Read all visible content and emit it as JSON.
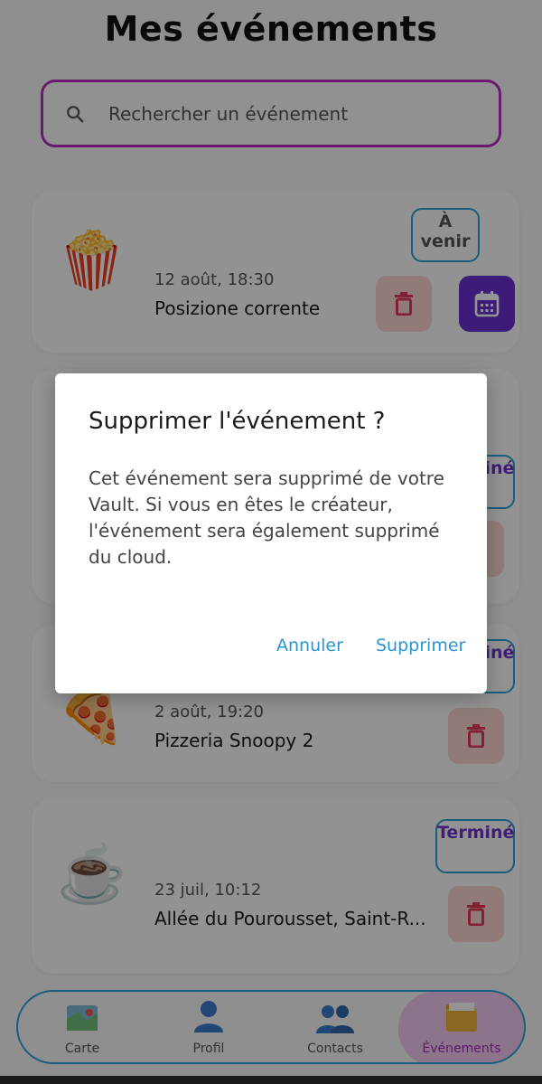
{
  "page": {
    "title": "Mes événements"
  },
  "search": {
    "placeholder": "Rechercher un événement",
    "value": ""
  },
  "events": [
    {
      "emoji": "🍿",
      "date": "12 août, 18:30",
      "place": "Posizione corrente",
      "status": "À venir"
    },
    {
      "emoji": "",
      "date": "",
      "place": "",
      "status": "Terminé"
    },
    {
      "emoji": "🍕",
      "date": "2 août, 19:20",
      "place": "Pizzeria Snoopy 2",
      "status": "Terminé"
    },
    {
      "emoji": "☕",
      "date": "23 juil, 10:12",
      "place": "Allée du Pourousset, Saint-R...",
      "status": "Terminé"
    }
  ],
  "nav": {
    "items": [
      {
        "label": "Carte",
        "icon": "map-icon"
      },
      {
        "label": "Profil",
        "icon": "profile-icon"
      },
      {
        "label": "Contacts",
        "icon": "contacts-icon"
      },
      {
        "label": "Événements",
        "icon": "events-folder-icon"
      }
    ],
    "active": "Événements"
  },
  "dialog": {
    "title": "Supprimer l'événement ?",
    "body": "Cet événement sera supprimé de votre Vault. Si vous en êtes le créateur, l'événement sera également supprimé du cloud.",
    "cancel_label": "Annuler",
    "confirm_label": "Supprimer"
  },
  "colors": {
    "accent_purple": "#6a2fd1",
    "search_border": "#b52bc4",
    "status_border": "#2aa0d8",
    "delete_bg": "#f9d4cf",
    "delete_icon": "#e0385a",
    "dialog_button": "#2b94d4"
  }
}
